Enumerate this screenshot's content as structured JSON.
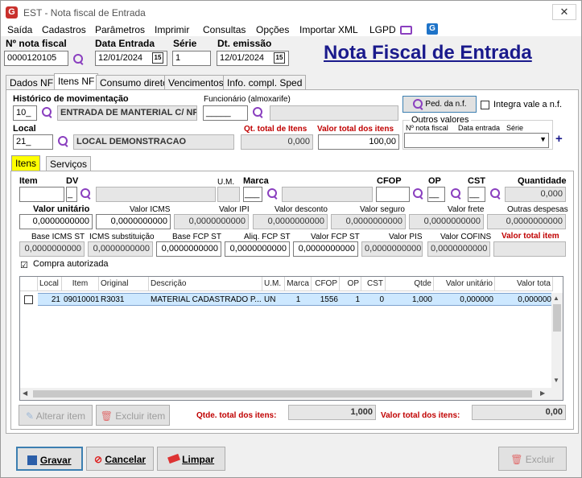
{
  "window": {
    "title": "EST - Nota fiscal de Entrada",
    "close": "✕",
    "app_icon": "G"
  },
  "menu": [
    "Saída",
    "Cadastros",
    "Parâmetros",
    "Imprimir",
    "Consultas",
    "Opções",
    "Importar XML",
    "LGPD"
  ],
  "header": {
    "numero_label": "Nº nota fiscal",
    "numero_value": "0000120105",
    "data_entrada_label": "Data Entrada",
    "data_entrada_value": "12/01/2024",
    "serie_label": "Série",
    "serie_value": "1",
    "dt_emissao_label": "Dt. emissão",
    "dt_emissao_value": "12/01/2024",
    "cal_icon": "15",
    "page_title": "Nota Fiscal de Entrada"
  },
  "tabs": [
    "Dados NF",
    "Itens NF",
    "Consumo direto",
    "Vencimentos",
    "Info. compl. Sped"
  ],
  "itens_nf": {
    "historico_label": "Histórico de movimentação",
    "historico_code": "10_",
    "historico_desc": "ENTRADA DE MANTERIAL C/ NF",
    "funcionario_label": "Funcionário (almoxarife)",
    "funcionario_value": "_____",
    "ped_btn": "Ped. da n.f.",
    "integra_label": "Integra vale a n.f.",
    "local_label": "Local",
    "local_code": "21_",
    "local_desc": "LOCAL DEMONSTRACAO",
    "qt_total_label": "Qt. total de Itens",
    "qt_total_value": "0,000",
    "valor_total_label": "Valor total dos itens",
    "valor_total_value": "100,00",
    "outros_label": "Outros valores",
    "outros_nf": "Nº nota fiscal",
    "outros_data": "Data entrada",
    "outros_serie": "Série",
    "plus": "+"
  },
  "subtabs": [
    "Itens",
    "Serviços"
  ],
  "item_form": {
    "item_label": "Item",
    "dv_label": "DV",
    "um_label": "U.M.",
    "marca_label": "Marca",
    "cfop_label": "CFOP",
    "op_label": "OP",
    "cst_label": "CST",
    "quantidade_label": "Quantidade",
    "dv_value": "_",
    "marca_value": "___",
    "op_value": "__",
    "cst_value": "__",
    "quantidade_value": "0,000",
    "row2_labels": [
      "Valor unitário",
      "Valor ICMS",
      "Valor IPI",
      "Valor desconto",
      "Valor seguro",
      "Valor frete",
      "Outras despesas"
    ],
    "row2_values": [
      "0,0000000000",
      "0,0000000000",
      "0,0000000000",
      "0,0000000000",
      "0,0000000000",
      "0,0000000000",
      "0,0000000000"
    ],
    "row3_labels": [
      "Base ICMS ST",
      "ICMS substituição",
      "Base FCP ST",
      "Aliq. FCP ST",
      "Valor FCP ST",
      "Valor PIS",
      "Valor COFINS",
      "Valor total item"
    ],
    "row3_values": [
      "0,0000000000",
      "0,0000000000",
      "0,0000000000",
      "0,0000000000",
      "0,0000000000",
      "0,0000000000",
      "0,0000000000",
      ""
    ],
    "compra_label": "Compra autorizada"
  },
  "grid": {
    "headers": [
      "",
      "Local",
      "Item",
      "Original",
      "Descrição",
      "U.M.",
      "Marca",
      "CFOP",
      "OP",
      "CST",
      "Qtde",
      "Valor unitário",
      "Valor tota"
    ],
    "rows": [
      [
        "",
        "21",
        "09010001",
        "R3031",
        "MATERIAL CADASTRADO P...",
        "UN",
        "1",
        "1556",
        "1",
        "0",
        "1,000",
        "0,000000",
        "0,000000"
      ]
    ]
  },
  "footer": {
    "alterar": "Alterar item",
    "excluir_item": "Excluir item",
    "qtde_total_label": "Qtde. total dos itens:",
    "qtde_total_value": "1,000",
    "valor_total_label": "Valor total dos itens:",
    "valor_total_value": "0,00"
  },
  "actions": {
    "gravar": "Gravar",
    "cancelar": "Cancelar",
    "limpar": "Limpar",
    "excluir": "Excluir"
  },
  "colors": {
    "accent": "#8a3fbf",
    "title_blue": "#1a1a8c",
    "red_label": "#c00000",
    "highlight_tab": "#ffff00"
  }
}
